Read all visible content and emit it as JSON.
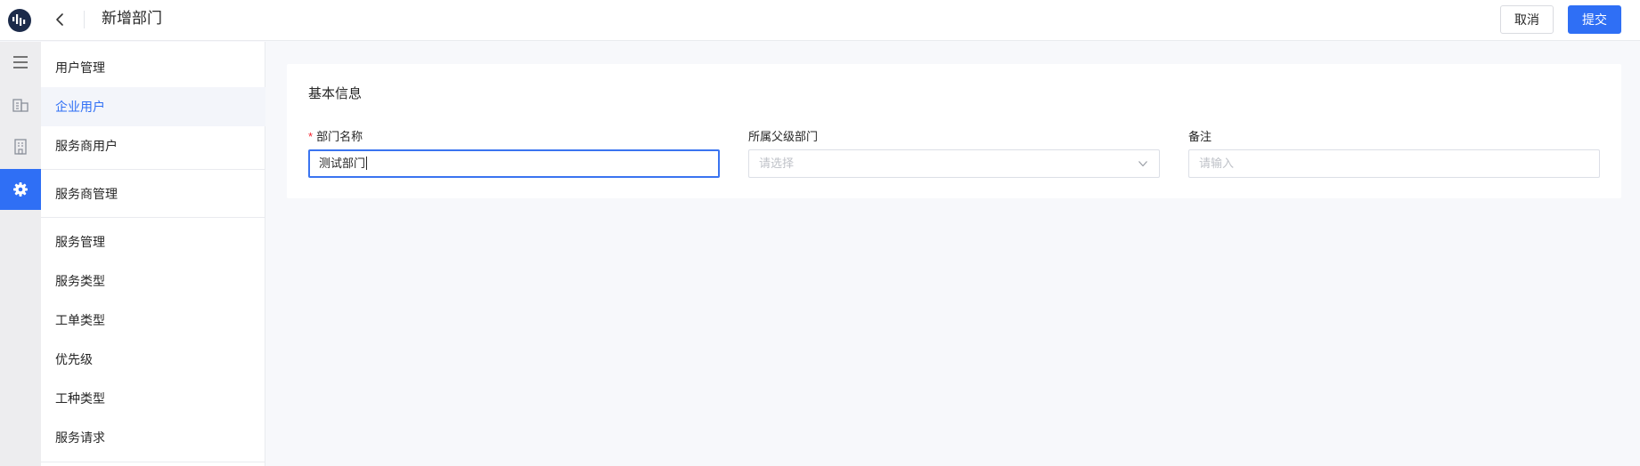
{
  "header": {
    "title": "新增部门",
    "cancel_label": "取消",
    "submit_label": "提交"
  },
  "rail": {
    "icons": [
      "menu-icon",
      "building-icon",
      "office-icon",
      "settings-icon"
    ],
    "active_index": 3,
    "accent_color": "#2f6ff5"
  },
  "submenu": {
    "group1": {
      "title": "用户管理",
      "items": [
        "企业用户",
        "服务商用户"
      ],
      "active_item": "企业用户"
    },
    "group2": {
      "title": "服务商管理"
    },
    "group3": {
      "title": "服务管理",
      "items": [
        "服务类型",
        "工单类型",
        "优先级",
        "工种类型",
        "服务请求"
      ]
    }
  },
  "form": {
    "section_title": "基本信息",
    "fields": [
      {
        "label": "部门名称",
        "required": true,
        "value": "测试部门",
        "placeholder": "",
        "type": "text",
        "focused": true
      },
      {
        "label": "所属父级部门",
        "required": false,
        "value": "",
        "placeholder": "请选择",
        "type": "select"
      },
      {
        "label": "备注",
        "required": false,
        "value": "",
        "placeholder": "请输入",
        "type": "text"
      }
    ]
  }
}
